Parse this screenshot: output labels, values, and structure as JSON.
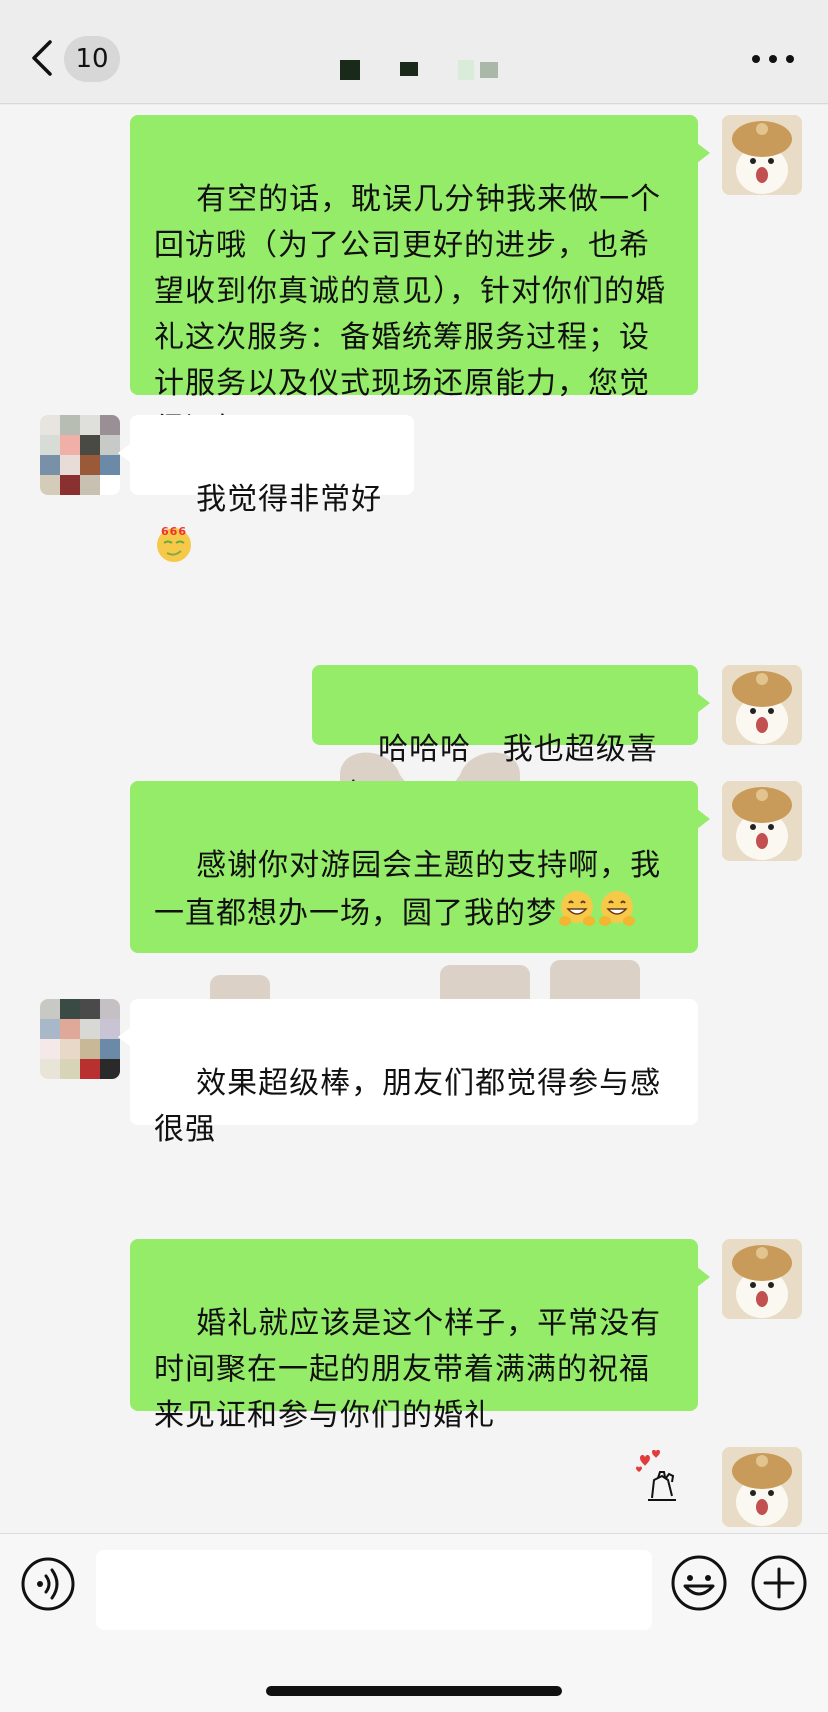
{
  "header": {
    "unread_count": "10",
    "back_icon": "chevron-left-icon",
    "more_icon": "more-dots-icon"
  },
  "messages": [
    {
      "sender": "self",
      "type": "text",
      "text": "有空的话，耽误几分钟我来做一个回访哦（为了公司更好的进步，也希望收到你真诚的意见），针对你们的婚礼这次服务：备婚统筹服务过程；设计服务以及仪式现场还原能力，您觉得还好吗?"
    },
    {
      "sender": "other",
      "type": "text",
      "text": "我觉得非常好",
      "emoji": "666-emoji",
      "emoji_text": "666"
    },
    {
      "sender": "self",
      "type": "text",
      "text": "哈哈哈   我也超级喜欢"
    },
    {
      "sender": "self",
      "type": "text",
      "text": "感谢你对游园会主题的支持啊，我一直都想办一场，圆了我的梦",
      "emoji": "grin-hands-emoji"
    },
    {
      "sender": "other",
      "type": "text",
      "text": "效果超级棒，朋友们都觉得参与感很强"
    },
    {
      "sender": "self",
      "type": "text",
      "text": "婚礼就应该是这个样子，平常没有时间聚在一起的朋友带着满满的祝福来见证和参与你们的婚礼"
    },
    {
      "sender": "self",
      "type": "sticker",
      "sticker": "hearts-hands-sticker"
    }
  ],
  "input_bar": {
    "voice_icon": "voice-icon",
    "text_value": "",
    "emoji_icon": "smiley-icon",
    "plus_icon": "plus-circle-icon"
  },
  "colors": {
    "self_bubble": "#95ec69",
    "other_bubble": "#ffffff",
    "background": "#ededed"
  }
}
